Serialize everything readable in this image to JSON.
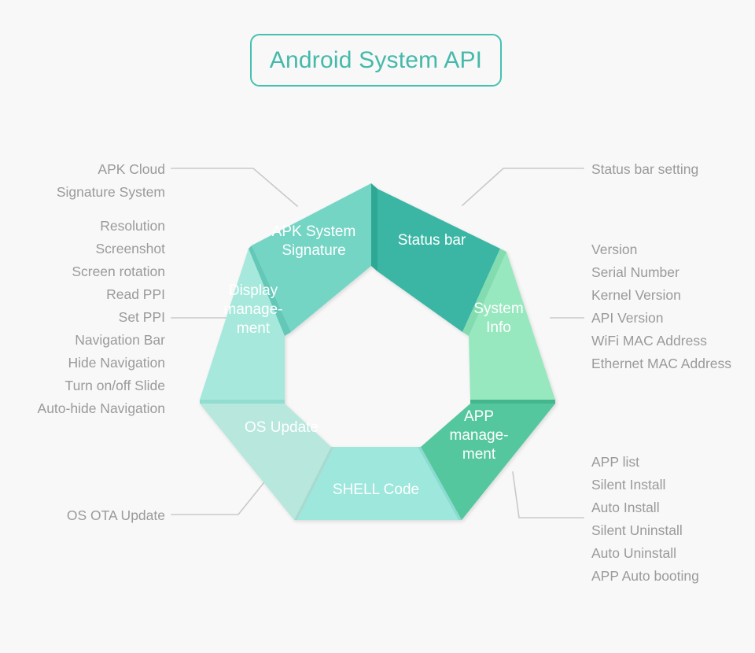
{
  "title": {
    "text": "Android System API",
    "border_color": "#45c1b0",
    "text_color": "#45b9aa"
  },
  "page": {
    "background": "#f8f8f8",
    "label_color": "#9a9a9a",
    "connector_color": "#c9c9c9"
  },
  "wheel": {
    "segments": [
      {
        "id": "status-bar",
        "label_lines": [
          "Status bar"
        ],
        "color": "#3bb6a4",
        "edge_color": "#2fa795"
      },
      {
        "id": "system-info",
        "label_lines": [
          "System",
          "Info"
        ],
        "color": "#97e8bf",
        "edge_color": "#83dcb0"
      },
      {
        "id": "app-management",
        "label_lines": [
          "APP",
          "manage-",
          "ment"
        ],
        "color": "#54c79e",
        "edge_color": "#45b78f"
      },
      {
        "id": "shell-code",
        "label_lines": [
          "SHELL Code"
        ],
        "color": "#9de7dd",
        "edge_color": "#8adbd0"
      },
      {
        "id": "os-update",
        "label_lines": [
          "OS Update"
        ],
        "color": "#b7e7dd",
        "edge_color": "#a5dbd0"
      },
      {
        "id": "display-management",
        "label_lines": [
          "Display",
          "manage-",
          "ment"
        ],
        "color": "#a6e8dc",
        "edge_color": "#93dcd0"
      },
      {
        "id": "apk-system-signature",
        "label_lines": [
          "APK System",
          "Signature"
        ],
        "color": "#74d5c5",
        "edge_color": "#63c8b7"
      }
    ]
  },
  "annotations": {
    "apk_cloud": {
      "target": "apk-system-signature",
      "lines": [
        "APK Cloud",
        "Signature System"
      ]
    },
    "display": {
      "target": "display-management",
      "lines": [
        "Resolution",
        "Screenshot",
        "Screen rotation",
        "Read PPI",
        "Set PPI",
        "Navigation Bar",
        "Hide Navigation",
        "Turn on/off Slide",
        "Auto-hide Navigation"
      ]
    },
    "os_ota": {
      "target": "os-update",
      "lines": [
        "OS OTA Update"
      ]
    },
    "status_bar": {
      "target": "status-bar",
      "lines": [
        "Status bar setting"
      ]
    },
    "system_info": {
      "target": "system-info",
      "lines": [
        "Version",
        "Serial Number",
        "Kernel Version",
        "API Version",
        "WiFi MAC Address",
        "Ethernet MAC Address"
      ]
    },
    "app_mgmt": {
      "target": "app-management",
      "lines": [
        "APP list",
        "Silent Install",
        "Auto Install",
        "Silent Uninstall",
        "Auto Uninstall",
        "APP Auto booting"
      ]
    }
  }
}
